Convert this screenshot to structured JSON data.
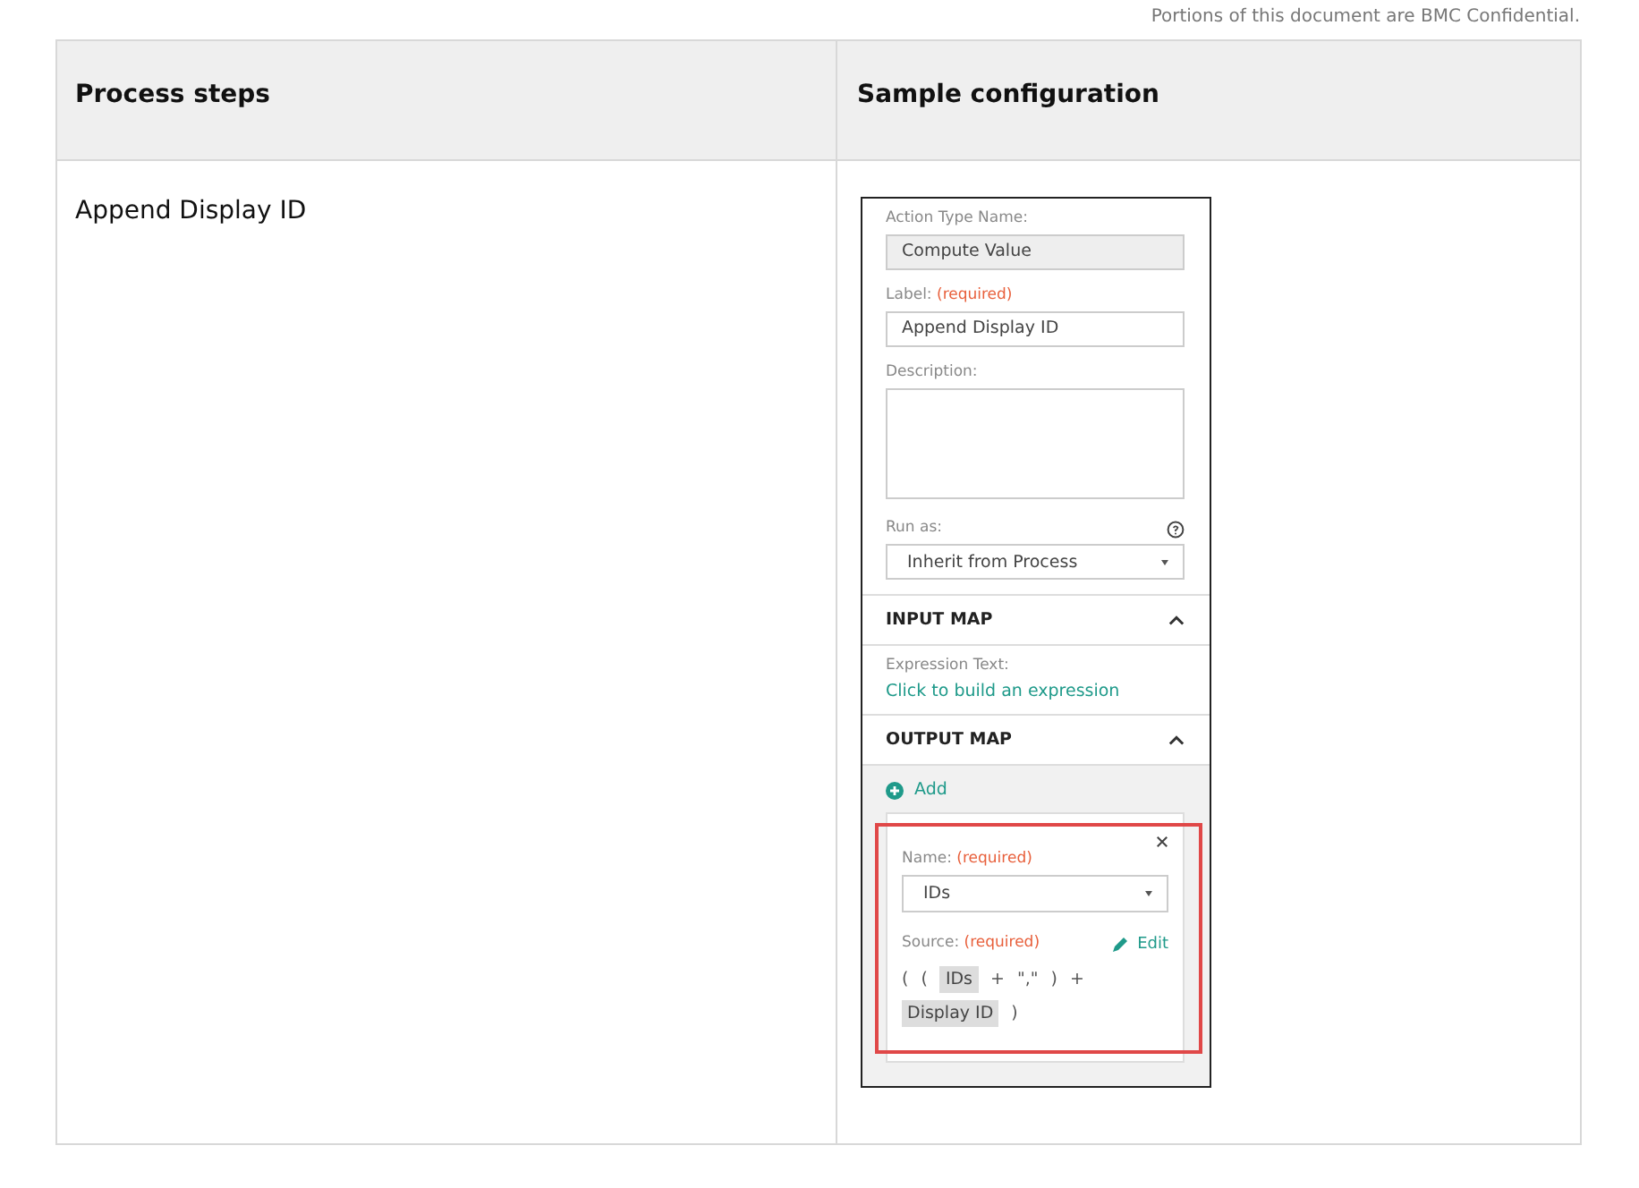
{
  "header_note": "Portions of this document are BMC Confidential.",
  "table": {
    "columns": [
      "Process steps",
      "Sample configuration"
    ],
    "rows": [
      {
        "step": "Append Display ID",
        "config": {
          "action_type": {
            "label": "Action Type Name:",
            "value": "Compute Value"
          },
          "label_field": {
            "label": "Label:",
            "required": "(required)",
            "value": "Append Display ID"
          },
          "description": {
            "label": "Description:"
          },
          "run_as": {
            "label": "Run as:",
            "value": "Inherit from Process"
          },
          "input_map": {
            "title": "INPUT MAP",
            "expanded": true,
            "expression_label": "Expression Text:",
            "link": "Click to build an expression"
          },
          "output_map": {
            "title": "OUTPUT MAP",
            "expanded": true,
            "add": "Add",
            "card": {
              "name_label": "Name:",
              "name_required": "(required)",
              "name_value": "IDs",
              "source_label": "Source:",
              "source_required": "(required)",
              "edit": "Edit",
              "tokens": [
                {
                  "kind": "plain",
                  "text": "("
                },
                {
                  "kind": "plain",
                  "text": "("
                },
                {
                  "kind": "chip",
                  "text": "IDs"
                },
                {
                  "kind": "plain",
                  "text": "+"
                },
                {
                  "kind": "plain",
                  "text": "\",\""
                },
                {
                  "kind": "plain",
                  "text": ")"
                },
                {
                  "kind": "plain",
                  "text": "+"
                },
                {
                  "kind": "chip",
                  "text": "Display ID"
                },
                {
                  "kind": "plain",
                  "text": ")"
                }
              ]
            }
          }
        }
      }
    ]
  }
}
